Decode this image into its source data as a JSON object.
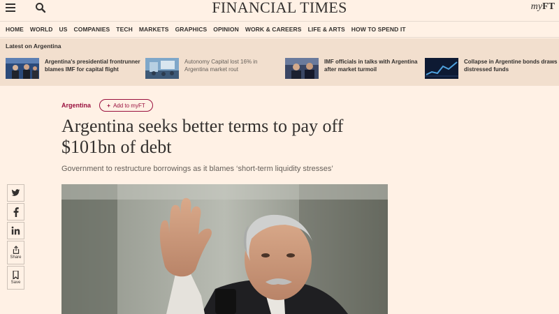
{
  "header": {
    "brand": "FINANCIAL TIMES",
    "myft_prefix": "my",
    "myft_suffix": "FT"
  },
  "nav": [
    "HOME",
    "WORLD",
    "US",
    "COMPANIES",
    "TECH",
    "MARKETS",
    "GRAPHICS",
    "OPINION",
    "WORK & CAREERS",
    "LIFE & ARTS",
    "HOW TO SPEND IT"
  ],
  "latest": {
    "title": "Latest on Argentina",
    "stories": [
      {
        "text": "Argentina's presidential frontrunner blames IMF for capital flight",
        "muted": false
      },
      {
        "text": "Autonomy Capital lost 16% in Argentina market rout",
        "muted": true
      },
      {
        "text": "IMF officials in talks with Argentina after market turmoil",
        "muted": false
      },
      {
        "text": "Collapse in Argentine bonds draws distressed funds",
        "muted": false
      }
    ]
  },
  "article": {
    "topic": "Argentina",
    "add_myft": "Add to myFT",
    "add_plus": "+",
    "headline": "Argentina seeks better terms to pay off $101bn of debt",
    "standfirst": "Government to restructure borrowings as it blames ‘short-term liquidity stresses’"
  },
  "share": {
    "share_label": "Share",
    "save_label": "Save"
  },
  "colors": {
    "background": "#fff1e5",
    "strip": "#f2dfce",
    "accent": "#990f3d",
    "text": "#33302e"
  },
  "icons": [
    "menu-icon",
    "search-icon",
    "twitter-icon",
    "facebook-icon",
    "linkedin-icon",
    "share-icon",
    "bookmark-icon"
  ]
}
